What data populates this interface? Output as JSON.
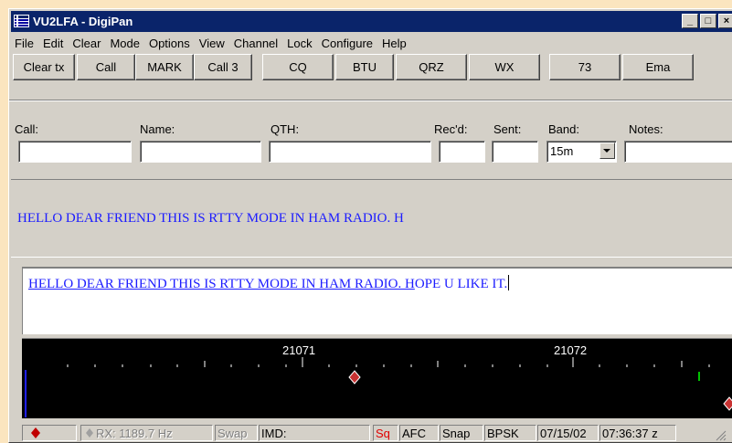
{
  "window": {
    "title": "VU2LFA - DigiPan",
    "minimize_label": "_",
    "maximize_label": "□",
    "close_label": "×"
  },
  "menu": [
    "File",
    "Edit",
    "Clear",
    "Mode",
    "Options",
    "View",
    "Channel",
    "Lock",
    "Configure",
    "Help"
  ],
  "toolbar": [
    "Clear tx",
    "Call",
    "MARK",
    "Call 3",
    "CQ",
    "BTU",
    "QRZ",
    "WX",
    "73",
    "Ema"
  ],
  "log_fields": {
    "call_label": "Call:",
    "name_label": "Name:",
    "qth_label": "QTH:",
    "recd_label": "Rec'd:",
    "sent_label": "Sent:",
    "band_label": "Band:",
    "notes_label": "Notes:",
    "call_value": "",
    "name_value": "",
    "qth_value": "",
    "recd_value": "",
    "sent_value": "",
    "band_value": "15m",
    "notes_value": ""
  },
  "receive_text": "HELLO DEAR FRIEND THIS IS RTTY MODE IN HAM RADIO. H",
  "transmit": {
    "sent_text": "HELLO DEAR FRIEND THIS IS RTTY MODE IN HAM RADIO. H",
    "pending_text": "OPE U LIKE IT."
  },
  "waterfall": {
    "freq_label_1": "21071",
    "freq_label_2": "21072"
  },
  "status": {
    "rx": "RX: 1189.7 Hz",
    "swap": "Swap",
    "imd": "IMD:",
    "sq": "Sq",
    "afc": "AFC",
    "snap": "Snap",
    "mode": "BPSK",
    "date": "07/15/02",
    "time": "07:36:37 z"
  },
  "colors": {
    "text_blue": "#1c1cff",
    "title_bar": "#0a246a",
    "squelch_red": "#e00000"
  }
}
